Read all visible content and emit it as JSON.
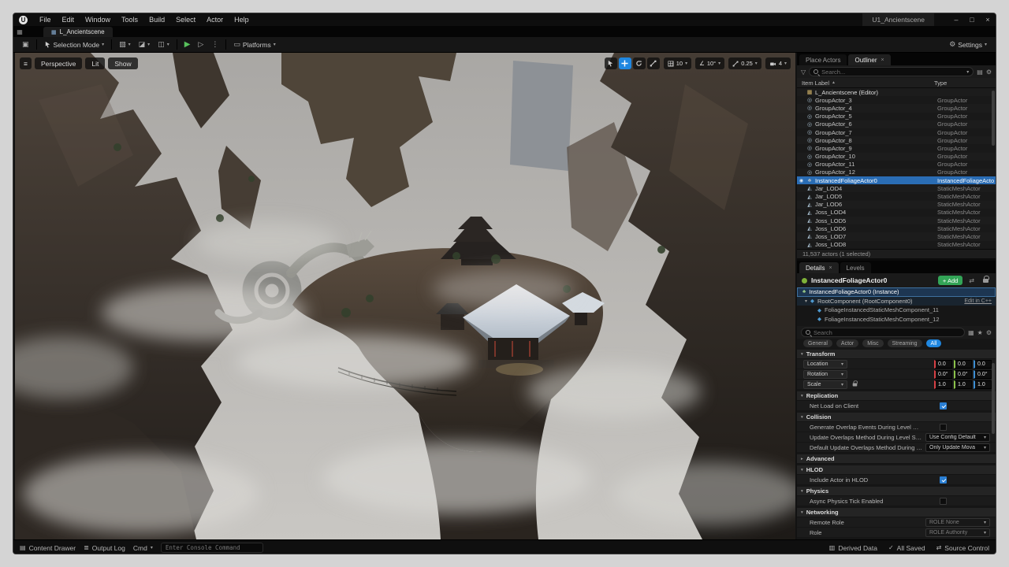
{
  "window": {
    "title": "U1_Ancientscene"
  },
  "menu": {
    "items": [
      "File",
      "Edit",
      "Window",
      "Tools",
      "Build",
      "Select",
      "Actor",
      "Help"
    ]
  },
  "level_tab": {
    "label": "L_Ancientscene"
  },
  "toolbar": {
    "selection_mode": "Selection Mode",
    "platforms": "Platforms",
    "settings": "Settings"
  },
  "viewport": {
    "perspective": "Perspective",
    "lit": "Lit",
    "show": "Show",
    "snap": {
      "grid": "10",
      "rotation": "10°",
      "scale": "0.25",
      "camera_speed": "4"
    }
  },
  "outliner": {
    "tabs": [
      {
        "label": "Place Actors"
      },
      {
        "label": "Outliner"
      }
    ],
    "search_placeholder": "Search...",
    "columns": {
      "item_label": "Item Label",
      "type": "Type"
    },
    "world_row": {
      "label": "L_Ancientscene (Editor)"
    },
    "rows": [
      {
        "label": "GroupActor_3",
        "type": "GroupActor",
        "icon": "group"
      },
      {
        "label": "GroupActor_4",
        "type": "GroupActor",
        "icon": "group"
      },
      {
        "label": "GroupActor_5",
        "type": "GroupActor",
        "icon": "group"
      },
      {
        "label": "GroupActor_6",
        "type": "GroupActor",
        "icon": "group"
      },
      {
        "label": "GroupActor_7",
        "type": "GroupActor",
        "icon": "group"
      },
      {
        "label": "GroupActor_8",
        "type": "GroupActor",
        "icon": "group"
      },
      {
        "label": "GroupActor_9",
        "type": "GroupActor",
        "icon": "group"
      },
      {
        "label": "GroupActor_10",
        "type": "GroupActor",
        "icon": "group"
      },
      {
        "label": "GroupActor_11",
        "type": "GroupActor",
        "icon": "group"
      },
      {
        "label": "GroupActor_12",
        "type": "GroupActor",
        "icon": "group"
      },
      {
        "label": "InstancedFoliageActor0",
        "type": "InstancedFoliageActor",
        "icon": "foliage",
        "selected": true
      },
      {
        "label": "Jar_LOD4",
        "type": "StaticMeshActor",
        "icon": "mesh"
      },
      {
        "label": "Jar_LOD5",
        "type": "StaticMeshActor",
        "icon": "mesh"
      },
      {
        "label": "Jar_LOD6",
        "type": "StaticMeshActor",
        "icon": "mesh"
      },
      {
        "label": "Joss_LOD4",
        "type": "StaticMeshActor",
        "icon": "mesh"
      },
      {
        "label": "Joss_LOD5",
        "type": "StaticMeshActor",
        "icon": "mesh"
      },
      {
        "label": "Joss_LOD6",
        "type": "StaticMeshActor",
        "icon": "mesh"
      },
      {
        "label": "Joss_LOD7",
        "type": "StaticMeshActor",
        "icon": "mesh"
      },
      {
        "label": "Joss_LOD8",
        "type": "StaticMeshActor",
        "icon": "mesh"
      }
    ],
    "footer": "11,537 actors (1 selected)"
  },
  "details": {
    "tabs": [
      {
        "label": "Details"
      },
      {
        "label": "Levels"
      }
    ],
    "actor_name": "InstancedFoliageActor0",
    "add_button": "+ Add",
    "components": [
      {
        "label": "InstancedFoliageActor0 (Instance)"
      },
      {
        "label": "RootComponent (RootComponent0)",
        "link": "Edit in C++"
      },
      {
        "label": "FoliageInstancedStaticMeshComponent_11"
      },
      {
        "label": "FoliageInstancedStaticMeshComponent_12"
      }
    ],
    "search_placeholder": "Search",
    "filters": [
      "General",
      "Actor",
      "Misc",
      "Streaming",
      "All"
    ],
    "transform": {
      "title": "Transform",
      "rows": [
        {
          "label": "Location",
          "values": [
            "0.0",
            "0.0",
            "0.0"
          ]
        },
        {
          "label": "Rotation",
          "values": [
            "0.0°",
            "0.0°",
            "0.0°"
          ]
        },
        {
          "label": "Scale",
          "values": [
            "1.0",
            "1.0",
            "1.0"
          ]
        }
      ]
    },
    "replication": {
      "title": "Replication",
      "rows": [
        {
          "label": "Net Load on Client",
          "checked": true
        }
      ]
    },
    "collision": {
      "title": "Collision",
      "rows": [
        {
          "label": "Generate Overlap Events During Level Streaming",
          "checked": false
        },
        {
          "label": "Update Overlaps Method During Level Streaming",
          "value": "Use Config Default"
        },
        {
          "label": "Default Update Overlaps Method During Level Streaming",
          "value": "Only Update Mova"
        }
      ]
    },
    "advanced": {
      "title": "Advanced"
    },
    "hlod": {
      "title": "HLOD",
      "rows": [
        {
          "label": "Include Actor in HLOD",
          "checked": true
        }
      ]
    },
    "physics": {
      "title": "Physics",
      "rows": [
        {
          "label": "Async Physics Tick Enabled",
          "checked": false
        }
      ]
    },
    "networking": {
      "title": "Networking",
      "rows": [
        {
          "label": "Remote Role",
          "value": "ROLE None"
        },
        {
          "label": "Role",
          "value": "ROLE Authority"
        }
      ]
    }
  },
  "status_bar": {
    "content_drawer": "Content Drawer",
    "output_log": "Output Log",
    "cmd": "Cmd",
    "console_placeholder": "Enter Console Command",
    "derived_data": "Derived Data",
    "all_saved": "All Saved",
    "source_control": "Source Control"
  },
  "icons": {
    "logo": "U",
    "minimize": "–",
    "maximize": "□",
    "close": "×",
    "hamburger": "≡",
    "save": "▣",
    "grid_tab": "▦",
    "dropdown": "▾",
    "expand": "▸",
    "play": "▶",
    "play2": "▷",
    "more": "⋮",
    "monitor": "▭",
    "gear": "⚙",
    "cube": "▧",
    "brush": "◪",
    "clapper": "◫",
    "eye": "◉",
    "folder": "▤",
    "star": "★",
    "grid9": "▦",
    "filter": "▽",
    "sort_up": "▲",
    "world": "▦",
    "group": "◎",
    "foliage": "♣",
    "mesh": "◭",
    "component": "◆",
    "check": "✓",
    "swap": "⇄",
    "angle": "∠",
    "outlog": "≣",
    "derived": "▥"
  },
  "colors": {
    "accent": "#1f87e0",
    "selection": "#2a6db5",
    "add_green": "#33a457",
    "play_green": "#58c15c",
    "axis_x": "#d64045",
    "axis_y": "#8bc24a",
    "axis_z": "#3d8fd4",
    "check_blue": "#2a7fd4"
  }
}
